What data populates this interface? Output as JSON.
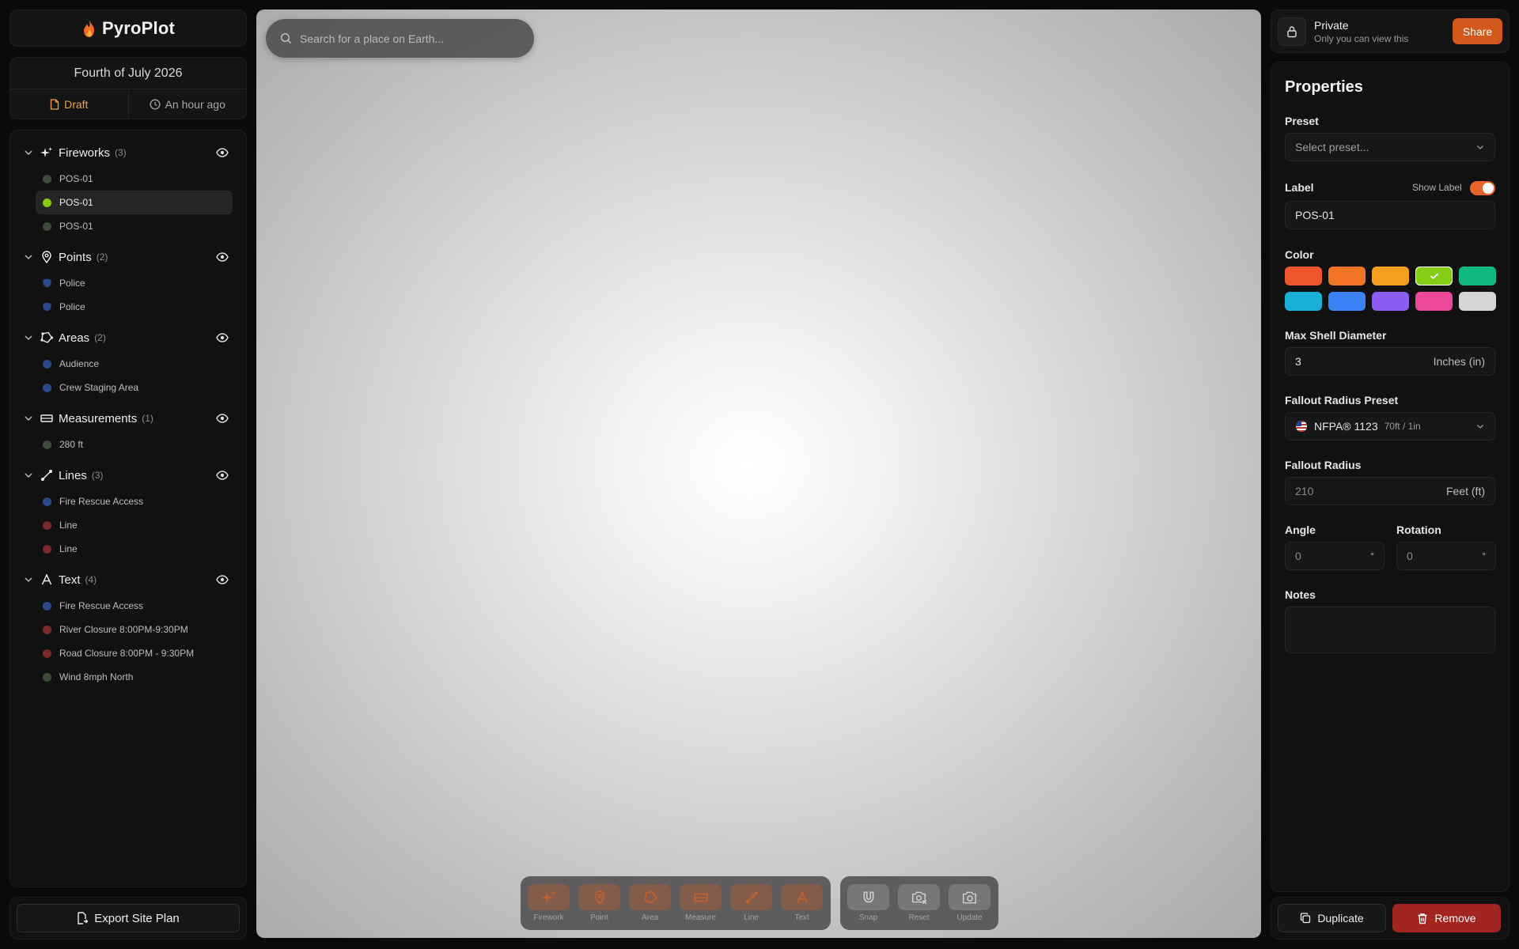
{
  "brand": {
    "name": "PyroPlot",
    "icon": "flame-icon"
  },
  "project": {
    "title": "Fourth of July 2026",
    "status": "Draft",
    "updated": "An hour ago"
  },
  "layers": {
    "fireworks": {
      "name": "Fireworks",
      "count": "(3)",
      "items": [
        {
          "label": "POS-01",
          "color": "#3e4a3a"
        },
        {
          "label": "POS-01",
          "color": "#84cc16"
        },
        {
          "label": "POS-01",
          "color": "#3e4a3a"
        }
      ]
    },
    "points": {
      "name": "Points",
      "count": "(2)",
      "items": [
        {
          "label": "Police",
          "color": "#2c4a8a"
        },
        {
          "label": "Police",
          "color": "#2c4a8a"
        }
      ]
    },
    "areas": {
      "name": "Areas",
      "count": "(2)",
      "items": [
        {
          "label": "Audience",
          "color": "#2c4a8a"
        },
        {
          "label": "Crew Staging Area",
          "color": "#2c4a8a"
        }
      ]
    },
    "measurements": {
      "name": "Measurements",
      "count": "(1)",
      "items": [
        {
          "label": "280 ft",
          "color": "#3e4a3a"
        }
      ]
    },
    "lines": {
      "name": "Lines",
      "count": "(3)",
      "items": [
        {
          "label": "Fire Rescue Access",
          "color": "#2c4a8a"
        },
        {
          "label": "Line",
          "color": "#7a2a2a"
        },
        {
          "label": "Line",
          "color": "#7a2a2a"
        }
      ]
    },
    "text": {
      "name": "Text",
      "count": "(4)",
      "items": [
        {
          "label": "Fire Rescue Access",
          "color": "#2c4a8a"
        },
        {
          "label": "River Closure 8:00PM-9:30PM",
          "color": "#7a2a2a"
        },
        {
          "label": "Road Closure 8:00PM - 9:30PM",
          "color": "#7a2a2a"
        },
        {
          "label": "Wind 8mph North",
          "color": "#3e4a3a"
        }
      ]
    }
  },
  "export_label": "Export Site Plan",
  "search": {
    "placeholder": "Search for a place on Earth..."
  },
  "toolbar": {
    "tools": [
      "Firework",
      "Point",
      "Area",
      "Measure",
      "Line",
      "Text"
    ],
    "actions": [
      "Snap",
      "Reset",
      "Update"
    ]
  },
  "privacy": {
    "title": "Private",
    "subtitle": "Only you can view this",
    "share_label": "Share"
  },
  "properties": {
    "title": "Properties",
    "preset_label": "Preset",
    "preset_placeholder": "Select preset...",
    "label_label": "Label",
    "show_label_text": "Show Label",
    "show_label_on": true,
    "label_value": "POS-01",
    "color_label": "Color",
    "colors": [
      "#f0562c",
      "#f27424",
      "#f4a01e",
      "#84cc16",
      "#10b981",
      "#1ab0d6",
      "#3b82f6",
      "#8b5cf6",
      "#ec4899",
      "#d4d4d4"
    ],
    "selected_color": "#84cc16",
    "max_shell_label": "Max Shell Diameter",
    "max_shell_value": "3",
    "max_shell_unit": "Inches (in)",
    "fallout_preset_label": "Fallout Radius Preset",
    "fallout_preset_value": "NFPA® 1123",
    "fallout_preset_detail": "70ft / 1in",
    "fallout_radius_label": "Fallout Radius",
    "fallout_radius_value": "210",
    "fallout_radius_unit": "Feet (ft)",
    "angle_label": "Angle",
    "angle_value": "0",
    "rotation_label": "Rotation",
    "rotation_value": "0",
    "degree_symbol": "°",
    "notes_label": "Notes",
    "notes_value": ""
  },
  "buttons": {
    "duplicate": "Duplicate",
    "remove": "Remove"
  }
}
